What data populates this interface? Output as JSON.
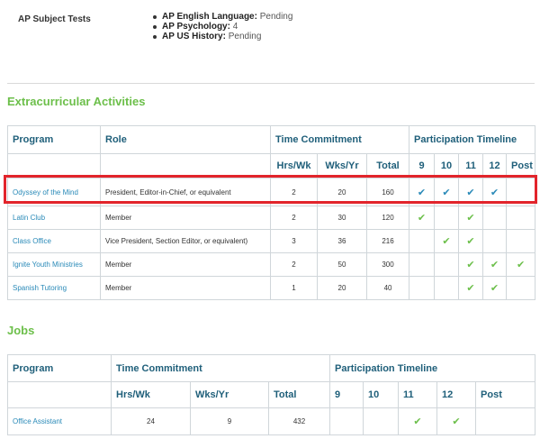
{
  "ap": {
    "label": "AP Subject Tests",
    "items": [
      {
        "subject": "AP English Language:",
        "status": " Pending"
      },
      {
        "subject": "AP Psychology:",
        "status": " 4"
      },
      {
        "subject": "AP US History:",
        "status": " Pending"
      }
    ]
  },
  "extracurricular": {
    "title": "Extracurricular Activities",
    "headers": {
      "program": "Program",
      "role": "Role",
      "time": "Time Commitment",
      "timeline": "Participation Timeline",
      "hrs": "Hrs/Wk",
      "wks": "Wks/Yr",
      "total": "Total",
      "g9": "9",
      "g10": "10",
      "g11": "11",
      "g12": "12",
      "post": "Post"
    },
    "rows": [
      {
        "program": "Odyssey of the Mind",
        "role": "President, Editor-in-Chief, or equivalent",
        "hrs": "2",
        "wks": "20",
        "total": "160",
        "timeline": [
          true,
          true,
          true,
          true,
          false
        ]
      },
      {
        "program": "Latin Club",
        "role": "Member",
        "hrs": "2",
        "wks": "30",
        "total": "120",
        "timeline": [
          true,
          false,
          true,
          false,
          false
        ]
      },
      {
        "program": "Class Office",
        "role": "Vice President, Section Editor, or equivalent)",
        "hrs": "3",
        "wks": "36",
        "total": "216",
        "timeline": [
          false,
          true,
          true,
          false,
          false
        ]
      },
      {
        "program": "Ignite Youth Ministries",
        "role": "Member",
        "hrs": "2",
        "wks": "50",
        "total": "300",
        "timeline": [
          false,
          false,
          true,
          true,
          true
        ]
      },
      {
        "program": "Spanish Tutoring",
        "role": "Member",
        "hrs": "1",
        "wks": "20",
        "total": "40",
        "timeline": [
          false,
          false,
          true,
          true,
          false
        ]
      }
    ]
  },
  "jobs": {
    "title": "Jobs",
    "headers": {
      "program": "Program",
      "time": "Time Commitment",
      "timeline": "Participation Timeline",
      "hrs": "Hrs/Wk",
      "wks": "Wks/Yr",
      "total": "Total",
      "g9": "9",
      "g10": "10",
      "g11": "11",
      "g12": "12",
      "post": "Post"
    },
    "rows": [
      {
        "program": "Office Assistant",
        "hrs": "24",
        "wks": "9",
        "total": "432",
        "timeline": [
          false,
          false,
          true,
          true,
          false
        ]
      }
    ]
  },
  "checkmark": "✔",
  "colors": {
    "accent_green": "#6cbf4a",
    "link_blue": "#2a8ab8",
    "header_blue": "#1f5f7a",
    "highlight_red": "#e2242b"
  }
}
